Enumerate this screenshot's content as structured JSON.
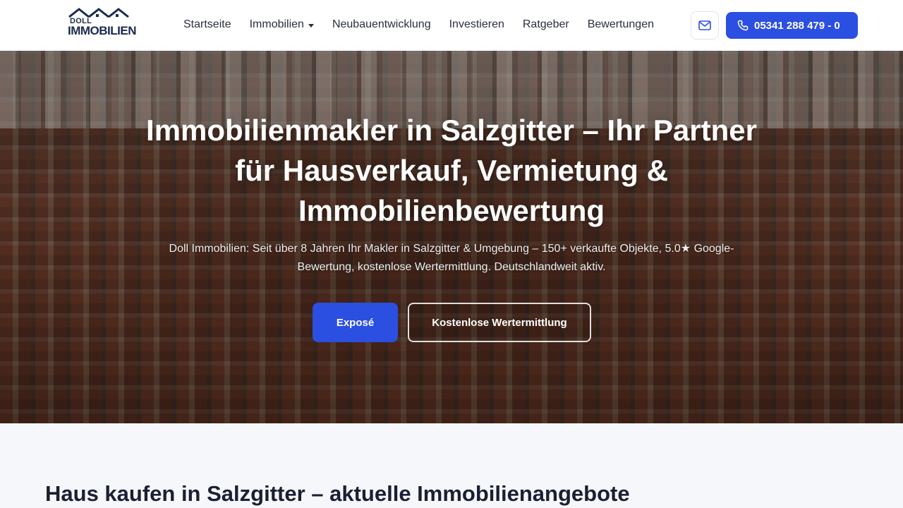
{
  "header": {
    "logo": {
      "top_text": "DOLL",
      "main_text": "IMMOBILIEN"
    },
    "nav": [
      {
        "label": "Startseite"
      },
      {
        "label": "Immobilien",
        "has_dropdown": true
      },
      {
        "label": "Neubauentwicklung"
      },
      {
        "label": "Investieren"
      },
      {
        "label": "Ratgeber"
      },
      {
        "label": "Bewertungen"
      }
    ],
    "mail_icon": "mail-icon",
    "phone": {
      "icon": "phone-icon",
      "label": "05341 288 479 - 0"
    }
  },
  "hero": {
    "title": "Immobilienmakler in Salzgitter – Ihr Partner für Hausverkauf, Vermietung & Immobilienbewertung",
    "subtitle": "Doll Immobilien: Seit über 8 Jahren Ihr Makler in Salzgitter & Umgebung – 150+ verkaufte Objekte, 5.0★ Google-Bewertung, kostenlose Wertermittlung. Deutschlandweit aktiv.",
    "primary_button": "Exposé",
    "secondary_button": "Kostenlose Wertermittlung"
  },
  "section": {
    "heading": "Haus kaufen in Salzgitter – aktuelle Immobilienangebote"
  },
  "colors": {
    "accent": "#2b4fe0",
    "brand_dark": "#1b2a4e"
  }
}
